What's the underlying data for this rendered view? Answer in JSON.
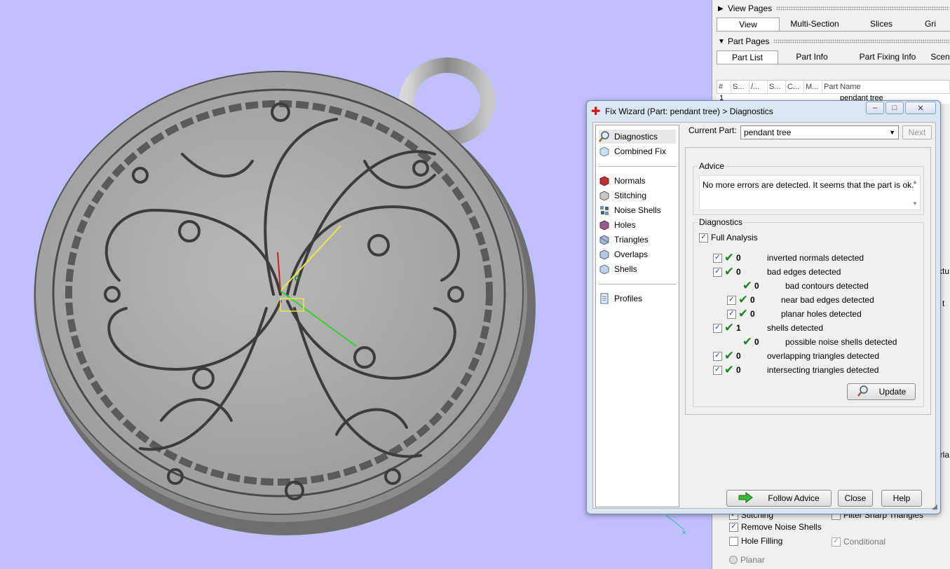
{
  "right_panel": {
    "view_pages": "View Pages",
    "view_tabs": [
      "View",
      "Multi-Section",
      "Slices",
      "Gri"
    ],
    "part_pages": "Part Pages",
    "part_tabs": [
      "Part List",
      "Part Info",
      "Part Fixing Info",
      "Scen"
    ],
    "columns": [
      "#",
      "S...",
      "/...",
      "S...",
      "C...",
      "M...",
      "Part Name"
    ],
    "row_number": "1",
    "row_name": "pendant tree",
    "side_fragments": [
      "xtu",
      "t",
      "erla"
    ],
    "options": [
      {
        "label": "Stitching",
        "checked": true
      },
      {
        "label": "Filter Sharp Triangles",
        "checked": false
      },
      {
        "label": "Remove Noise Shells",
        "checked": true
      },
      {
        "label": "Hole Filling",
        "checked": false
      },
      {
        "label": "Conditional",
        "checked": true
      },
      {
        "label": "Planar",
        "checked": true
      }
    ]
  },
  "dialog": {
    "title": "Fix Wizard (Part: pendant tree) > Diagnostics",
    "current_part_label": "Current Part:",
    "current_part_value": "pendant tree",
    "next_label": "Next",
    "nav": {
      "diagnostics": "Diagnostics",
      "combined_fix": "Combined Fix",
      "normals": "Normals",
      "stitching": "Stitching",
      "noise_shells": "Noise Shells",
      "holes": "Holes",
      "triangles": "Triangles",
      "overlaps": "Overlaps",
      "shells": "Shells",
      "profiles": "Profiles"
    },
    "advice_legend": "Advice",
    "advice_text": "No more errors are detected. It seems that the part is ok.",
    "diagnostics_legend": "Diagnostics",
    "full_analysis": "Full Analysis",
    "rows": [
      {
        "count": "0",
        "label": "inverted normals detected"
      },
      {
        "count": "0",
        "label": "bad edges detected"
      },
      {
        "count": "0",
        "label": "bad contours detected"
      },
      {
        "count": "0",
        "label": "near bad edges detected"
      },
      {
        "count": "0",
        "label": "planar holes detected"
      },
      {
        "count": "1",
        "label": "shells detected"
      },
      {
        "count": "0",
        "label": "possible noise shells detected"
      },
      {
        "count": "0",
        "label": "overlapping triangles detected"
      },
      {
        "count": "0",
        "label": "intersecting triangles detected"
      }
    ],
    "update_label": "Update",
    "follow_advice_label": "Follow Advice",
    "close_label": "Close",
    "help_label": "Help"
  }
}
